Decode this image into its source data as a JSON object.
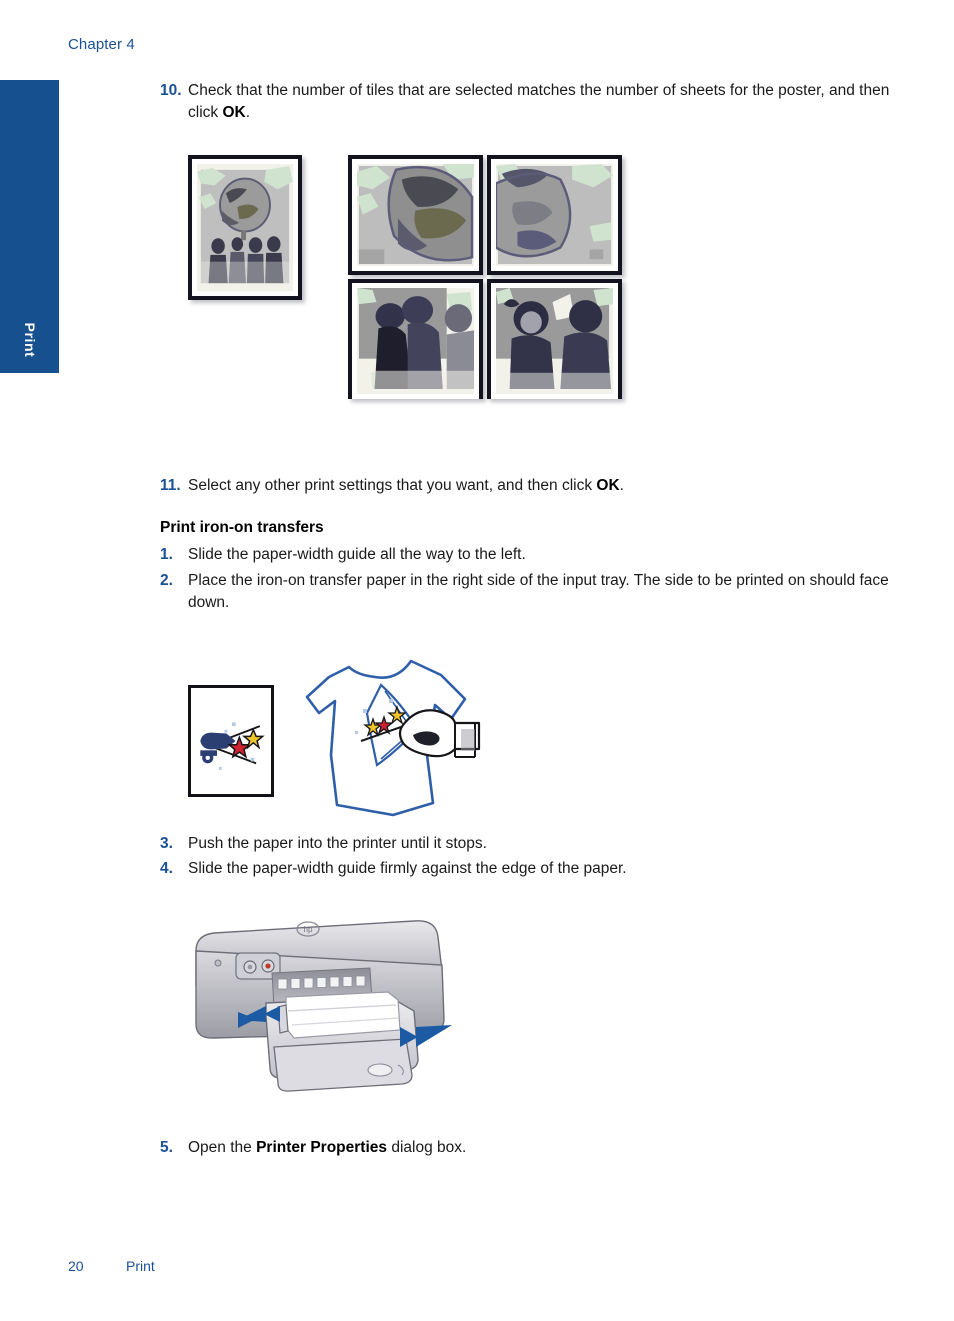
{
  "header": {
    "chapter": "Chapter 4"
  },
  "side_tab": {
    "label": "Print",
    "color": "#17508f"
  },
  "colors": {
    "accent_blue": "#1a5194",
    "tab_blue": "#17508f",
    "body_text": "#1a1a1a"
  },
  "steps_poster": [
    {
      "number": "10.",
      "text_before": "Check that the number of tiles that are selected matches the number of sheets for the poster, and then click ",
      "bold": "OK",
      "text_after": "."
    },
    {
      "number": "11.",
      "text_before": "Select any other print settings that you want, and then click ",
      "bold": "OK",
      "text_after": "."
    }
  ],
  "section": {
    "heading": "Print iron-on transfers"
  },
  "steps_ironon": [
    {
      "number": "1.",
      "text_before": "Slide the paper-width guide all the way to the left.",
      "bold": "",
      "text_after": ""
    },
    {
      "number": "2.",
      "text_before": "Place the iron-on transfer paper in the right side of the input tray. The side to be printed on should face down.",
      "bold": "",
      "text_after": ""
    },
    {
      "number": "3.",
      "text_before": "Push the paper into the printer until it stops.",
      "bold": "",
      "text_after": ""
    },
    {
      "number": "4.",
      "text_before": "Slide the paper-width guide firmly against the edge of the paper.",
      "bold": "",
      "text_after": ""
    },
    {
      "number": "5.",
      "text_before": "Open the ",
      "bold": "Printer Properties",
      "text_after": " dialog box."
    }
  ],
  "figures": {
    "poster": {
      "name": "poster-tiling-illustration",
      "description": "Small framed photo of a globe with people, beside a 2-by-2 grid of enlarged poster tiles",
      "tile_count": 4
    },
    "ironon": {
      "name": "iron-on-transfer-illustration",
      "description": "Transfer sheet showing a cannon firing stars, and a t-shirt outline with a hand pressing the transfer on"
    },
    "printer": {
      "name": "printer-paper-loading-illustration",
      "description": "HP Deskjet printer with paper loaded in the input tray and two blue arrows showing the paper-width guide direction"
    }
  },
  "footer": {
    "page_number": "20",
    "section_name": "Print"
  }
}
